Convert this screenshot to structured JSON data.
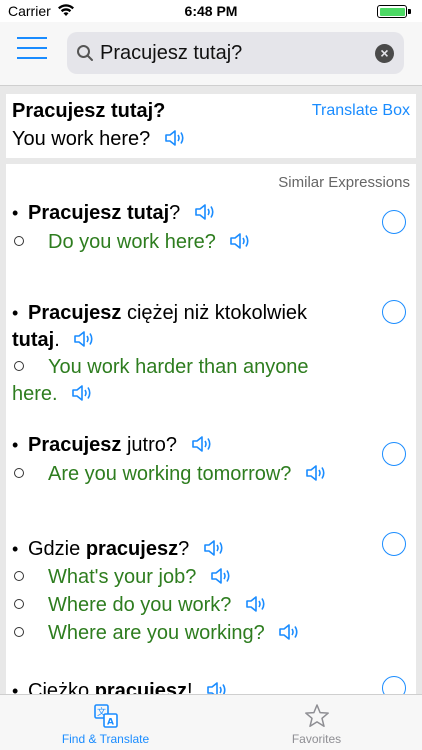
{
  "status_bar": {
    "carrier": "Carrier",
    "time": "6:48 PM"
  },
  "search": {
    "value": "Pracujesz tutaj?",
    "clear_label": "×"
  },
  "translation": {
    "source": "Pracujesz tutaj?",
    "target": "You work here?",
    "translate_box_label": "Translate Box"
  },
  "similar": {
    "header": "Similar Expressions",
    "items": [
      {
        "source_bold": "Pracujesz tutaj",
        "source_rest": "?",
        "translations": [
          "Do you work here?"
        ]
      },
      {
        "source_bold": "Pracujesz",
        "source_mid": " ciężej niż ktokolwiek",
        "source_bold2": "tutaj",
        "source_rest": ".",
        "translation_line1": "You work harder than anyone",
        "translation_line2": "here."
      },
      {
        "source_bold": "Pracujesz",
        "source_rest": " jutro?",
        "translations": [
          "Are you working tomorrow?"
        ]
      },
      {
        "source_pre": "Gdzie ",
        "source_bold": "pracujesz",
        "source_rest": "?",
        "translations": [
          "What's your job?",
          "Where do you work?",
          "Where are you working?"
        ]
      },
      {
        "source_pre": "Ciężko ",
        "source_bold": "pracujesz",
        "source_rest": "!"
      }
    ]
  },
  "tabs": [
    {
      "label": "Find & Translate",
      "icon": "translate-icon",
      "active": true
    },
    {
      "label": "Favorites",
      "icon": "star-icon",
      "active": false
    }
  ],
  "colors": {
    "accent": "#1a8cff",
    "translation_text": "#2e7d1f"
  }
}
